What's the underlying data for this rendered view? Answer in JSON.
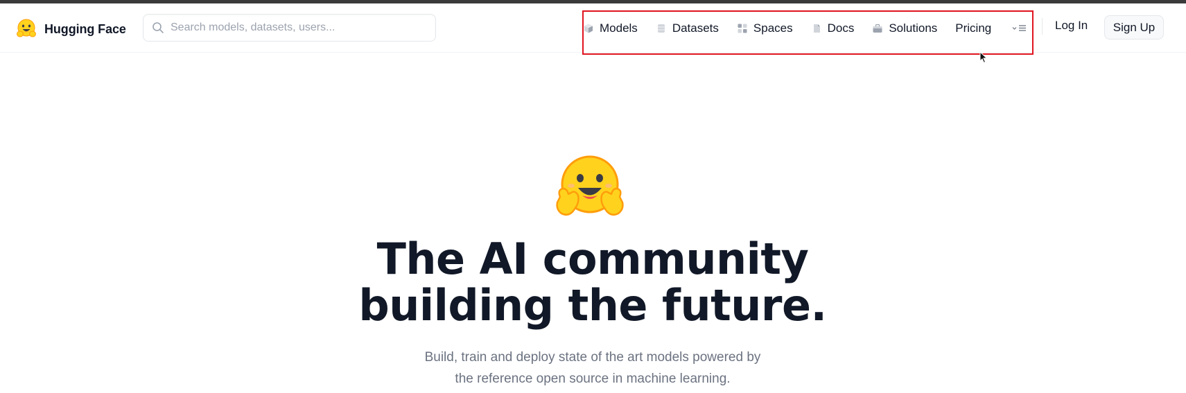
{
  "brand": {
    "name": "Hugging Face",
    "logo_icon": "hugging-face-emoji-icon"
  },
  "search": {
    "placeholder": "Search models, datasets, users...",
    "value": ""
  },
  "nav": {
    "items": [
      {
        "label": "Models",
        "icon": "cube-icon"
      },
      {
        "label": "Datasets",
        "icon": "database-icon"
      },
      {
        "label": "Spaces",
        "icon": "grid-icon"
      },
      {
        "label": "Docs",
        "icon": "document-icon"
      },
      {
        "label": "Solutions",
        "icon": "briefcase-icon"
      },
      {
        "label": "Pricing",
        "icon": ""
      }
    ],
    "more_icon": "more-menu-icon"
  },
  "auth": {
    "login_label": "Log In",
    "signup_label": "Sign Up"
  },
  "hero": {
    "title_line1": "The AI community",
    "title_line2": "building the future.",
    "subtitle_line1": "Build, train and deploy state of the art models powered by",
    "subtitle_line2": "the reference open source in machine learning."
  },
  "colors": {
    "highlight": "#e0141f",
    "text": "#111827",
    "muted": "#6b7280",
    "emoji": "#ffd21e"
  }
}
